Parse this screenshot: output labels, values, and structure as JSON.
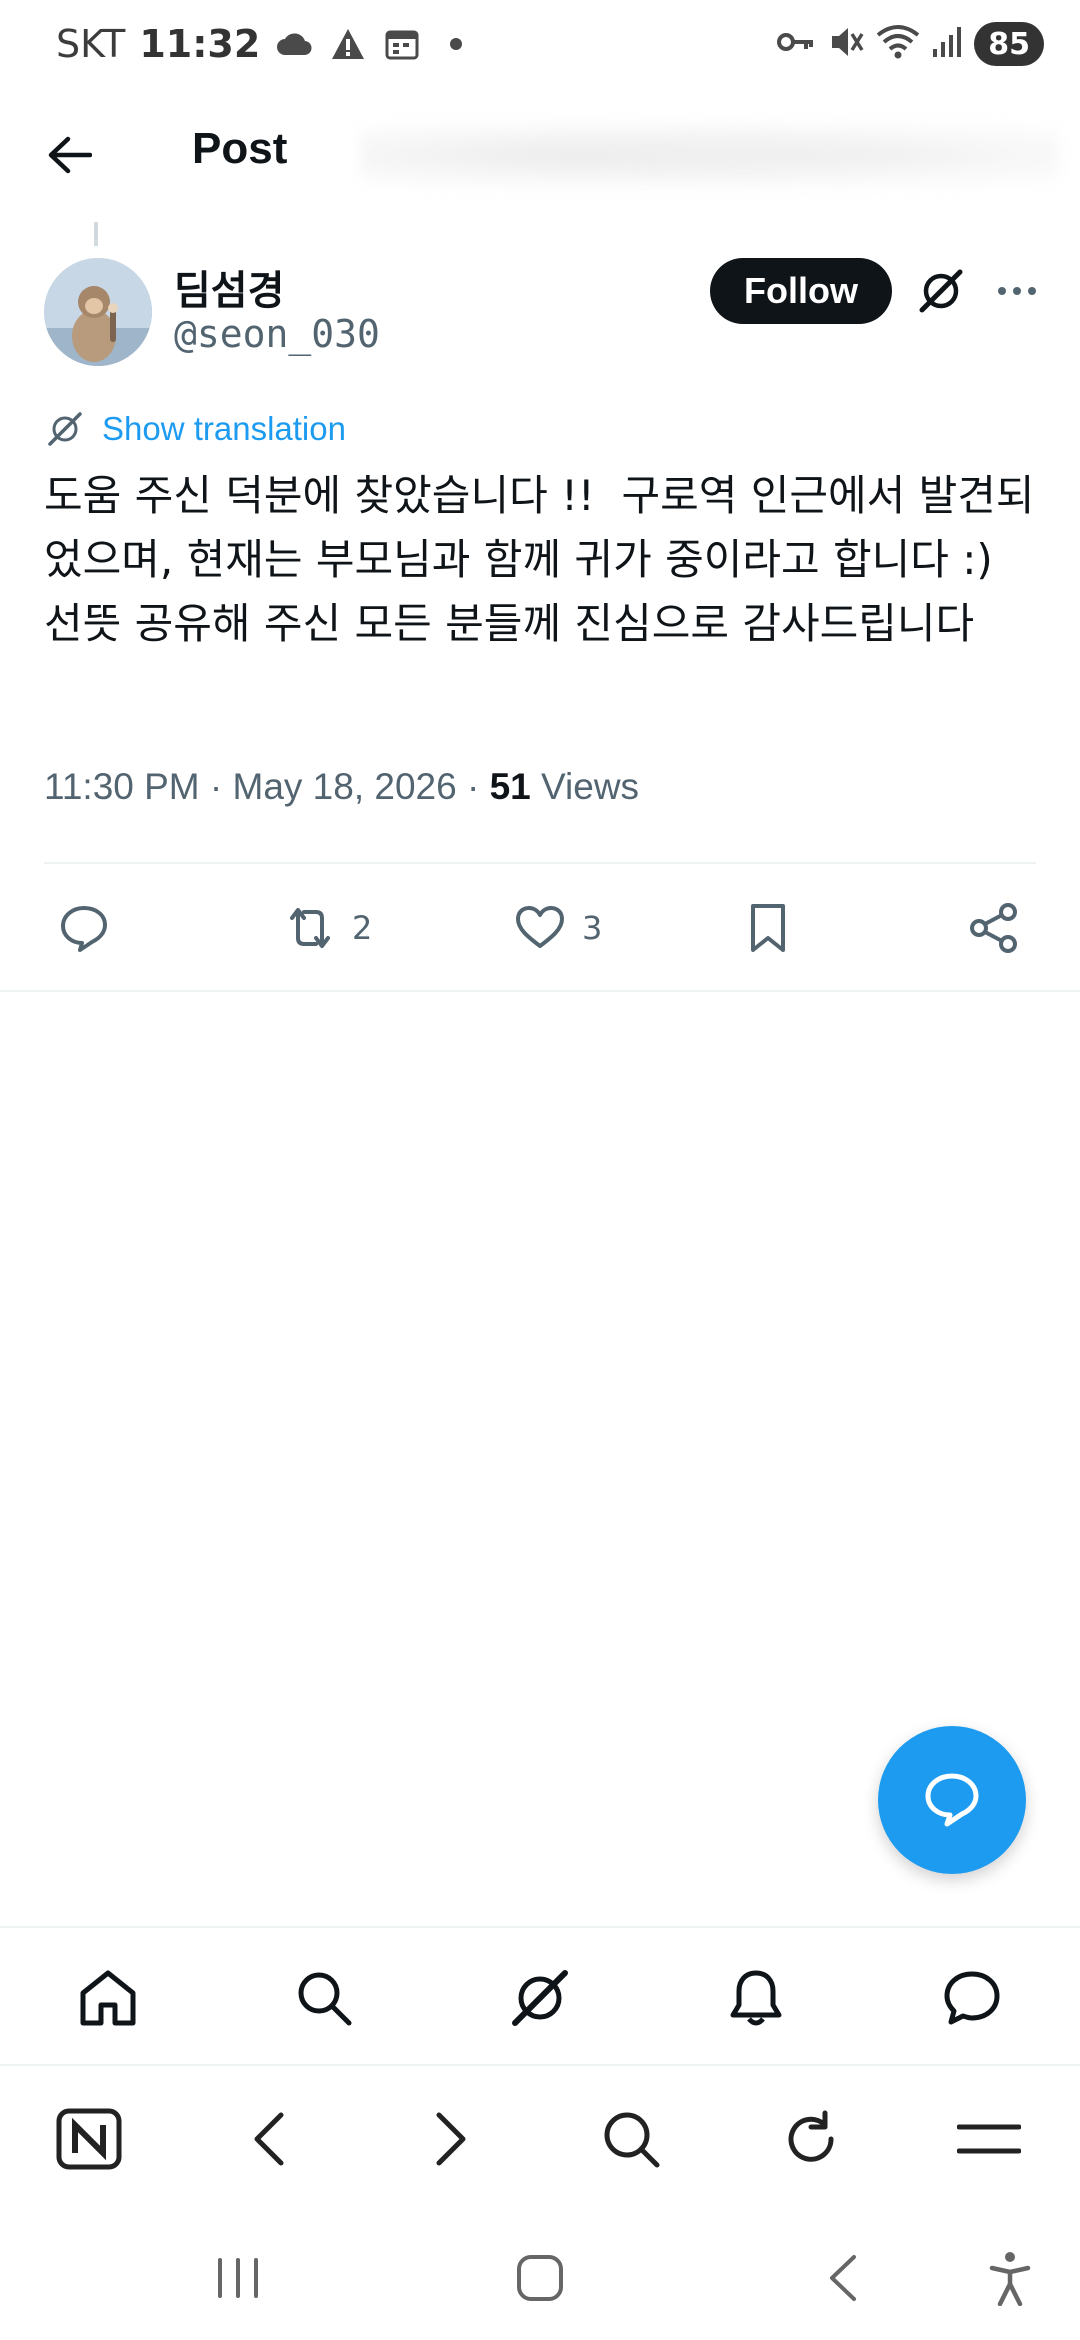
{
  "status_bar": {
    "carrier": "SKT",
    "time": "11:32",
    "battery": "85",
    "icons_left": [
      "cloud-icon",
      "warning-icon",
      "calendar-icon",
      "dot-icon"
    ],
    "icons_right": [
      "key-icon",
      "mute-icon",
      "wifi-icon",
      "signal-icon"
    ]
  },
  "header": {
    "title": "Post"
  },
  "author": {
    "name": "딤섬경",
    "handle": "@seon_030",
    "follow_label": "Follow"
  },
  "post": {
    "translation_label": "Show translation",
    "text": "도움 주신 덕분에 찾았습니다 !!  구로역 인근에서 발견되었으며, 현재는 부모님과 함께 귀가 중이라고 합니다 :)   선뜻 공유해 주신 모든 분들께 진심으로 감사드립니다",
    "timestamp": "11:30 PM · May 18, 2026 · ",
    "views_count": "51",
    "views_label": " Views"
  },
  "actions": {
    "reply_count": "",
    "repost_count": "2",
    "like_count": "3"
  },
  "bottom_nav": {
    "items": [
      "home-icon",
      "search-icon",
      "grok-icon",
      "notifications-icon",
      "messages-icon"
    ]
  },
  "browser_bar": {
    "items": [
      "naver-icon",
      "back-icon",
      "forward-icon",
      "search-icon",
      "reload-icon",
      "menu-icon"
    ]
  },
  "system_nav": {
    "items": [
      "recents-icon",
      "home-icon",
      "back-icon",
      "accessibility-icon"
    ]
  },
  "colors": {
    "accent": "#1d9bf0",
    "text_primary": "#0f1419",
    "text_secondary": "#536471",
    "follow_bg": "#0f1419"
  }
}
